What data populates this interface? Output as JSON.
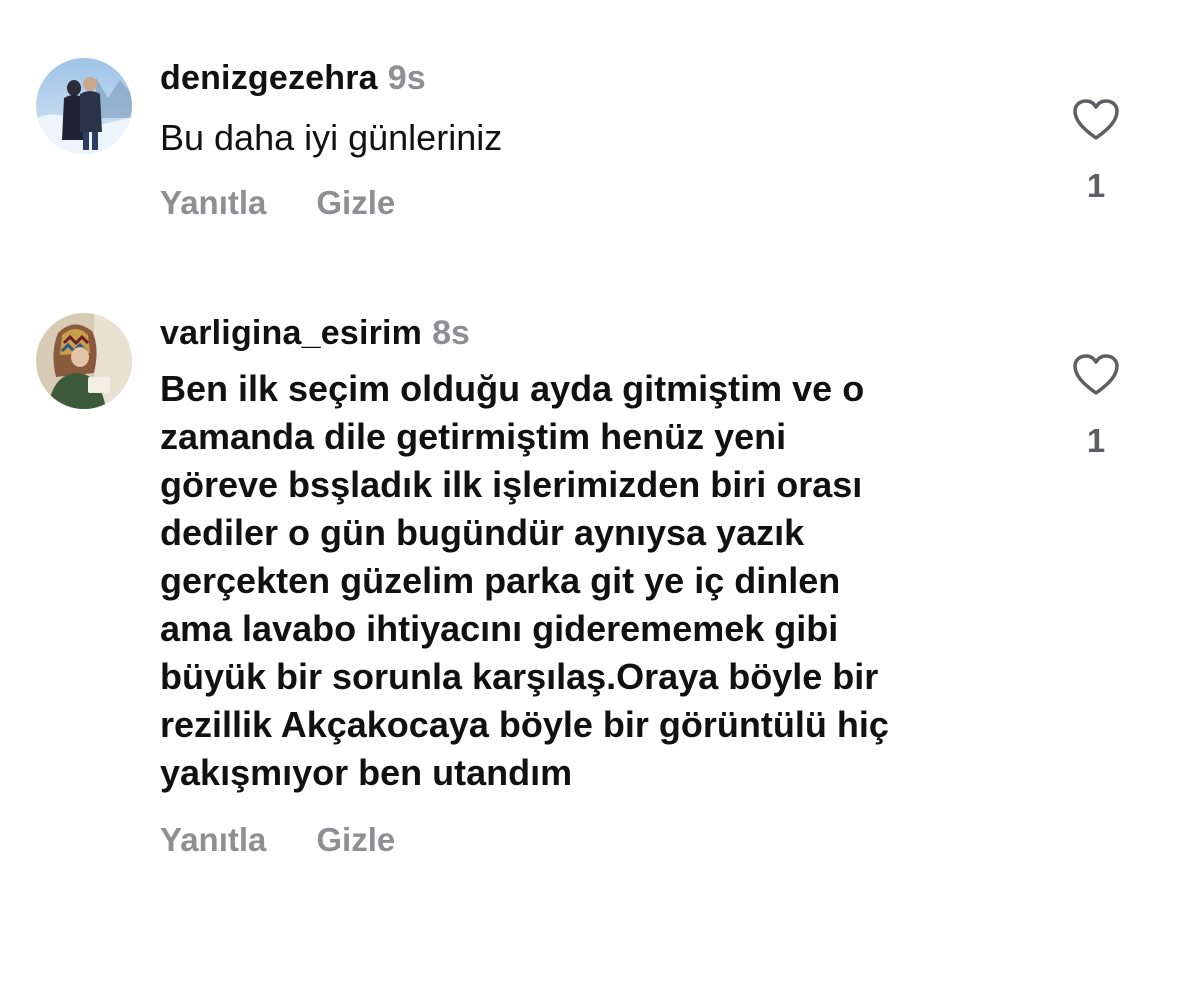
{
  "comments": [
    {
      "username": "denizgezehra",
      "time": "9s",
      "text": "Bu daha iyi günleriniz",
      "reply_label": "Yanıtla",
      "hide_label": "Gizle",
      "like_count": "1",
      "avatar_icon": "profile-photo-couple-snow",
      "like_icon": "heart-outline-icon"
    },
    {
      "username": "varligina_esirim",
      "time": "8s",
      "text_lines": [
        "Ben ilk seçim olduğu ayda gitmiştim ve o",
        "zamanda dile getirmiştim henüz yeni",
        "göreve bsşladık ilk işlerimizden biri orası",
        "dediler o gün bugündür aynıysa yazık",
        "gerçekten güzelim parka git ye iç dinlen",
        "ama lavabo ihtiyacını giderememek gibi",
        "büyük bir sorunla karşılaş.Oraya böyle bir",
        "rezillik Akçakocaya böyle bir görüntülü hiç",
        "yakışmıyor ben utandım"
      ],
      "reply_label": "Yanıtla",
      "hide_label": "Gizle",
      "like_count": "1",
      "avatar_icon": "profile-photo-woman-headscarf",
      "like_icon": "heart-outline-icon"
    }
  ],
  "colors": {
    "text": "#111111",
    "muted": "#8e8e93",
    "like_count": "#5e5e63",
    "heart_stroke": "#5e5e63"
  }
}
